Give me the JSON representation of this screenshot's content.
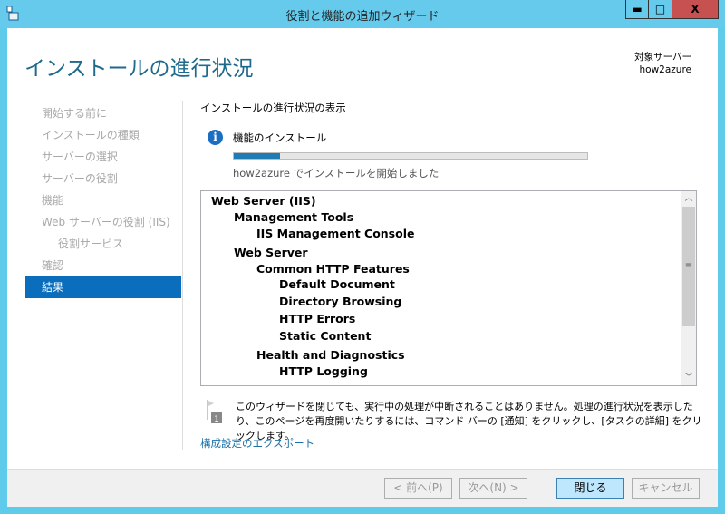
{
  "window": {
    "title": "役割と機能の追加ウィザード",
    "minimize": "▬",
    "maximize": "□",
    "close": "X"
  },
  "header": {
    "title": "インストールの進行状況",
    "target_label": "対象サーバー",
    "target_value": "how2azure"
  },
  "nav": {
    "items": [
      {
        "label": "開始する前に",
        "active": false
      },
      {
        "label": "インストールの種類",
        "active": false
      },
      {
        "label": "サーバーの選択",
        "active": false
      },
      {
        "label": "サーバーの役割",
        "active": false
      },
      {
        "label": "機能",
        "active": false
      },
      {
        "label": "Web サーバーの役割 (IIS)",
        "active": false
      },
      {
        "label": "役割サービス",
        "active": false,
        "sub": true
      },
      {
        "label": "確認",
        "active": false
      },
      {
        "label": "結果",
        "active": true
      }
    ]
  },
  "main": {
    "section_title": "インストールの進行状況の表示",
    "feature_label": "機能のインストール",
    "progress_percent": 13,
    "progress_text": "how2azure でインストールを開始しました",
    "tree": [
      {
        "label": "Web Server (IIS)",
        "level": 0
      },
      {
        "label": "Management Tools",
        "level": 1
      },
      {
        "label": "IIS Management Console",
        "level": 2
      },
      {
        "label": "Web Server",
        "level": 1
      },
      {
        "label": "Common HTTP Features",
        "level": 2
      },
      {
        "label": "Default Document",
        "level": 3
      },
      {
        "label": "Directory Browsing",
        "level": 3
      },
      {
        "label": "HTTP Errors",
        "level": 3
      },
      {
        "label": "Static Content",
        "level": 3
      },
      {
        "label": "Health and Diagnostics",
        "level": 2
      },
      {
        "label": "HTTP Logging",
        "level": 3
      }
    ],
    "note_badge": "1",
    "note": "このウィザードを閉じても、実行中の処理が中断されることはありません。処理の進行状況を表示したり、このページを再度開いたりするには、コマンド バーの [通知] をクリックし、[タスクの詳細] をクリックします。",
    "export_link": "構成設定のエクスポート"
  },
  "footer": {
    "prev": "< 前へ(P)",
    "next": "次へ(N) >",
    "close": "閉じる",
    "cancel": "キャンセル"
  }
}
